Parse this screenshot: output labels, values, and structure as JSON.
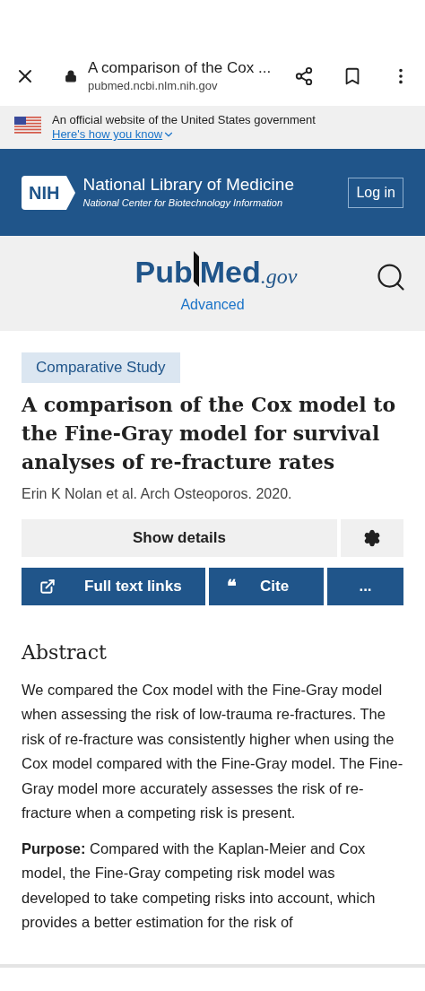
{
  "browser": {
    "title": "A comparison of the Cox ...",
    "url": "pubmed.ncbi.nlm.nih.gov"
  },
  "gov_banner": {
    "text": "An official website of the United States government",
    "link": "Here's how you know"
  },
  "nih_header": {
    "badge": "NIH",
    "title": "National Library of Medicine",
    "subtitle": "National Center for Biotechnology Information",
    "login": "Log in"
  },
  "pubmed": {
    "logo_left": "Pub",
    "logo_right": "Med",
    "logo_suffix": ".gov",
    "advanced": "Advanced"
  },
  "article": {
    "tag": "Comparative Study",
    "title": "A comparison of the Cox model to the Fine-Gray model for survival analyses of re-fracture rates",
    "byline": "Erin K Nolan et al. Arch Osteoporos. 2020.",
    "show_details": "Show details",
    "actions": [
      {
        "kind": "link",
        "label": "Full text links"
      },
      {
        "kind": "cite",
        "label": "Cite",
        "icon": "❝"
      },
      {
        "kind": "more",
        "label": "..."
      }
    ]
  },
  "abstract": {
    "heading": "Abstract",
    "paragraphs": [
      "We compared the Cox model with the Fine-Gray model when assessing the risk of low-trauma re-fractures. The risk of re-fracture was consistently higher when using the Cox model compared with the Fine-Gray model. The Fine-Gray model more accurately assesses the risk of re-fracture when a competing risk is present.",
      "**Purpose:** Compared with the Kaplan-Meier and Cox model, the Fine-Gray competing risk model was developed to take competing risks into account, which provides a better estimation for the risk of"
    ]
  }
}
